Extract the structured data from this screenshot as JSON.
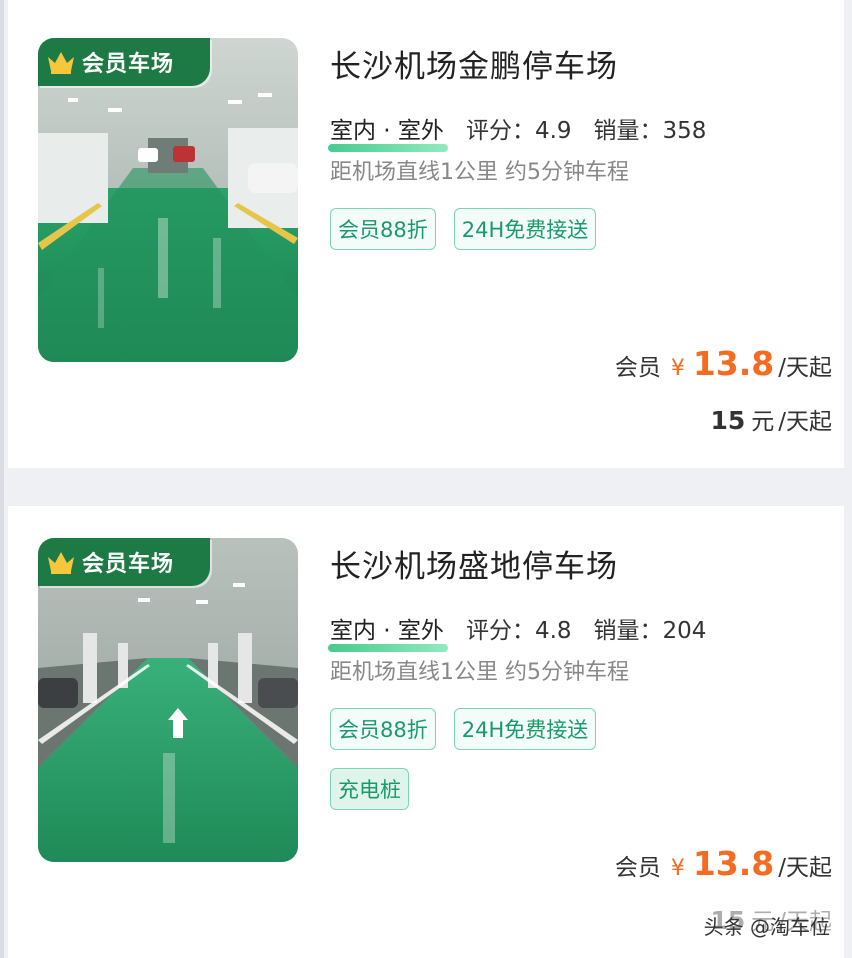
{
  "lots": [
    {
      "badge": "会员车场",
      "name": "长沙机场金鹏停车场",
      "type": "室内 · 室外",
      "rating": "评分：4.9",
      "sales": "销量：358",
      "distance": "距机场直线1公里 约5分钟车程",
      "tags": [
        "会员88折",
        "24H免费接送"
      ],
      "member_prefix": "会员",
      "currency": "¥",
      "member_price": "13.8",
      "unit": "/天起",
      "normal_price": "15",
      "yuan": "元",
      "normal_unit": "/天起"
    },
    {
      "badge": "会员车场",
      "name": "长沙机场盛地停车场",
      "type": "室内 · 室外",
      "rating": "评分：4.8",
      "sales": "销量：204",
      "distance": "距机场直线1公里 约5分钟车程",
      "tags": [
        "会员88折",
        "24H免费接送",
        "充电桩"
      ],
      "member_prefix": "会员",
      "currency": "¥",
      "member_price": "13.8",
      "unit": "/天起",
      "normal_price": "15",
      "yuan": "元",
      "normal_unit": "/天起"
    }
  ],
  "watermark": "头条 @淘车位",
  "icons": {
    "badge_icon": "crown-icon",
    "watermark_icon": "toutiao-logo"
  },
  "colors": {
    "brand_green": "#1d7a45",
    "tag_green": "#1a9a6c",
    "price_orange": "#f36c21"
  }
}
